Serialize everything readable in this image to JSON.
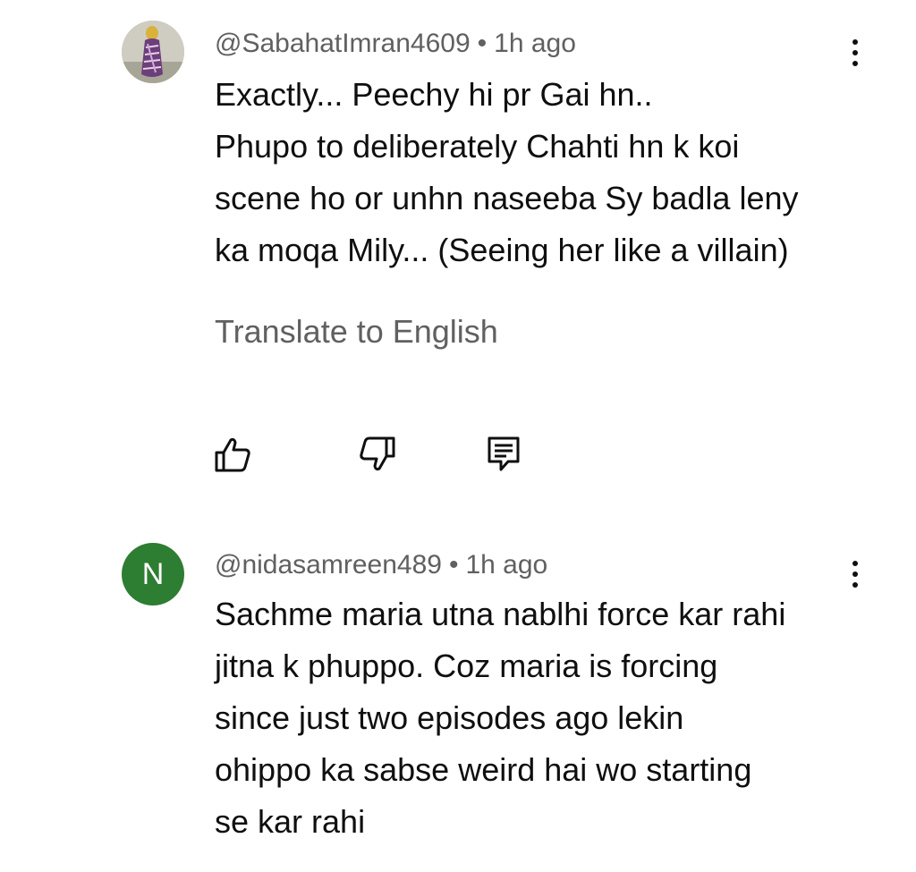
{
  "comments": [
    {
      "author": "@SabahatImran4609",
      "separator": "•",
      "time": "1h ago",
      "lines": [
        "Exactly... Peechy hi pr Gai hn..",
        "Phupo to deliberately Chahti hn k koi",
        "scene ho or unhn naseeba Sy badla leny",
        "ka moqa Mily... (Seeing her like a villain)"
      ],
      "translate_label": "Translate to English",
      "avatar_icon": "profile-photo",
      "actions": {
        "like_icon": "thumbs-up-icon",
        "dislike_icon": "thumbs-down-icon",
        "reply_icon": "reply-comment-icon"
      }
    },
    {
      "author": "@nidasamreen489",
      "separator": "•",
      "time": "1h ago",
      "avatar_letter": "N",
      "avatar_color": "#2d7d32",
      "lines": [
        "Sachme maria utna nablhi force kar rahi",
        "jitna k phuppo. Coz maria is forcing",
        "since just two episodes ago lekin",
        "ohippo ka sabse weird hai wo starting",
        "se kar rahi"
      ]
    }
  ],
  "colors": {
    "text_primary": "#0f0f0f",
    "text_secondary": "#606060",
    "background": "#ffffff"
  }
}
